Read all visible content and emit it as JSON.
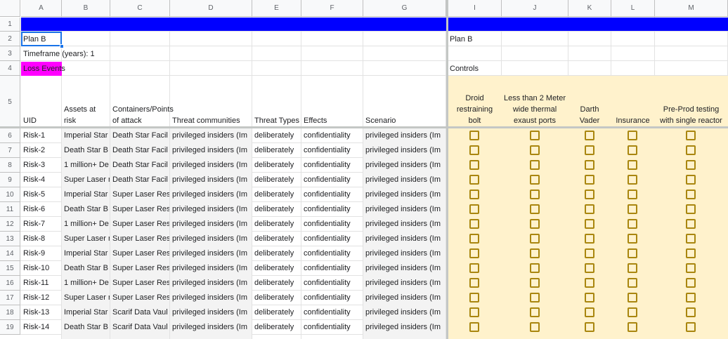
{
  "columns": [
    "A",
    "B",
    "C",
    "D",
    "E",
    "F",
    "G",
    "I",
    "J",
    "K",
    "L",
    "M"
  ],
  "row_numbers": [
    "1",
    "2",
    "3",
    "4",
    "5",
    "6",
    "7",
    "8",
    "9",
    "10",
    "11",
    "12",
    "13",
    "14",
    "15",
    "16",
    "17",
    "18",
    "19"
  ],
  "meta": {
    "plan_left": "Plan B",
    "timeframe": "Timeframe (years): 1",
    "loss_events": "Loss Events",
    "plan_right": "Plan B",
    "controls": "Controls"
  },
  "headers_left": [
    "UID",
    "Assets at risk",
    "Containers/Points of attack",
    "Threat communities",
    "Threat Types",
    "Effects",
    "Scenario"
  ],
  "headers_controls": [
    "Droid restraining bolt",
    "Less than 2 Meter wide thermal exaust ports",
    "Darth Vader",
    "Insurance",
    "Pre-Prod testing with single reactor"
  ],
  "rows": [
    [
      "Risk-1",
      "Imperial Star",
      "Death Star Facil",
      "privileged insiders (Im",
      "deliberately",
      "confidentiality",
      "privileged insiders (Im"
    ],
    [
      "Risk-2",
      "Death Star B",
      "Death Star Facil",
      "privileged insiders (Im",
      "deliberately",
      "confidentiality",
      "privileged insiders (Im"
    ],
    [
      "Risk-3",
      "1 million+ De",
      "Death Star Facil",
      "privileged insiders (Im",
      "deliberately",
      "confidentiality",
      "privileged insiders (Im"
    ],
    [
      "Risk-4",
      "Super Laser r",
      "Death Star Facil",
      "privileged insiders (Im",
      "deliberately",
      "confidentiality",
      "privileged insiders (Im"
    ],
    [
      "Risk-5",
      "Imperial Star",
      "Super Laser Res",
      "privileged insiders (Im",
      "deliberately",
      "confidentiality",
      "privileged insiders (Im"
    ],
    [
      "Risk-6",
      "Death Star B",
      "Super Laser Res",
      "privileged insiders (Im",
      "deliberately",
      "confidentiality",
      "privileged insiders (Im"
    ],
    [
      "Risk-7",
      "1 million+ De",
      "Super Laser Res",
      "privileged insiders (Im",
      "deliberately",
      "confidentiality",
      "privileged insiders (Im"
    ],
    [
      "Risk-8",
      "Super Laser r",
      "Super Laser Res",
      "privileged insiders (Im",
      "deliberately",
      "confidentiality",
      "privileged insiders (Im"
    ],
    [
      "Risk-9",
      "Imperial Star",
      "Super Laser Res",
      "privileged insiders (Im",
      "deliberately",
      "confidentiality",
      "privileged insiders (Im"
    ],
    [
      "Risk-10",
      "Death Star B",
      "Super Laser Res",
      "privileged insiders (Im",
      "deliberately",
      "confidentiality",
      "privileged insiders (Im"
    ],
    [
      "Risk-11",
      "1 million+ De",
      "Super Laser Res",
      "privileged insiders (Im",
      "deliberately",
      "confidentiality",
      "privileged insiders (Im"
    ],
    [
      "Risk-12",
      "Super Laser r",
      "Super Laser Res",
      "privileged insiders (Im",
      "deliberately",
      "confidentiality",
      "privileged insiders (Im"
    ],
    [
      "Risk-13",
      "Imperial Star",
      "Scarif Data Vaul",
      "privileged insiders (Im",
      "deliberately",
      "confidentiality",
      "privileged insiders (Im"
    ],
    [
      "Risk-14",
      "Death Star B",
      "Scarif Data Vaul",
      "privileged insiders (Im",
      "deliberately",
      "confidentiality",
      "privileged insiders (Im"
    ]
  ],
  "colors": {
    "band": "#0000ff",
    "controls_fill": "#fff2cc",
    "loss_events_fill": "#ff00ff",
    "checkbox": "#a9860f",
    "selection": "#1a73e8"
  },
  "icons": {
    "checkbox": "checkbox-unchecked-icon"
  }
}
